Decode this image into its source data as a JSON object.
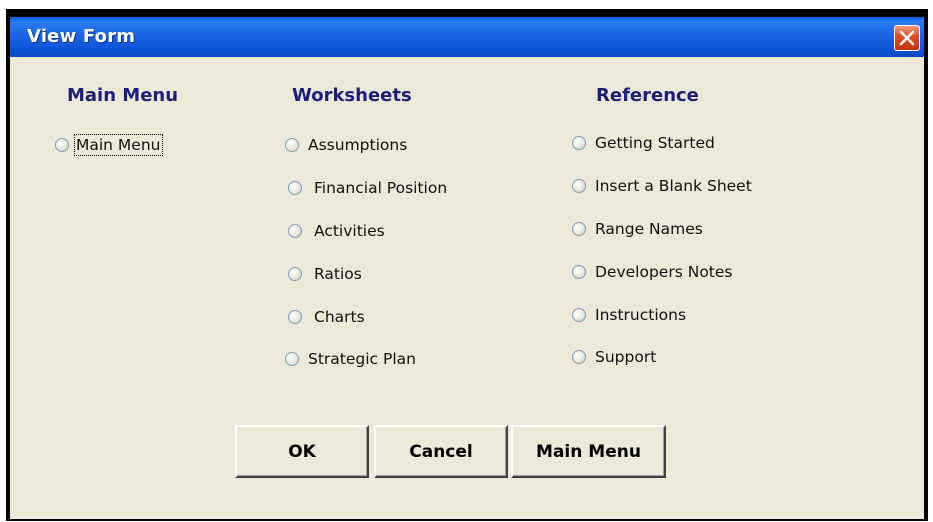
{
  "window": {
    "title": "View Form",
    "close_icon": "close-icon"
  },
  "sections": {
    "main_menu": {
      "heading": "Main Menu",
      "options": [
        "Main Menu"
      ]
    },
    "worksheets": {
      "heading": "Worksheets",
      "options": [
        "Assumptions",
        "Financial Position",
        "Activities",
        "Ratios",
        "Charts",
        "Strategic Plan"
      ]
    },
    "reference": {
      "heading": "Reference",
      "options": [
        "Getting Started",
        "Insert a Blank Sheet",
        "Range Names",
        "Developers Notes",
        "Instructions",
        "Support"
      ]
    }
  },
  "buttons": {
    "ok": "OK",
    "cancel": "Cancel",
    "main_menu": "Main Menu"
  },
  "colors": {
    "title_bar": "#1d66e6",
    "client": "#ece9d8",
    "heading": "#1b1f7a",
    "close": "#dd4a1f"
  }
}
